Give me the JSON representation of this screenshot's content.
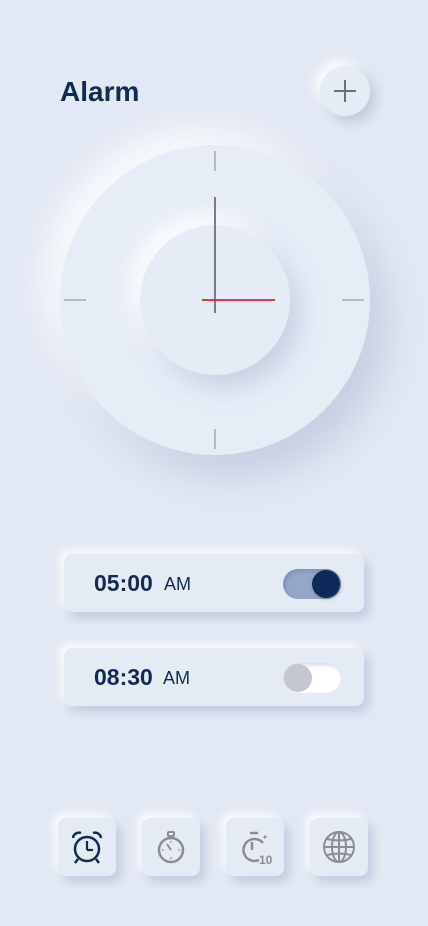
{
  "header": {
    "title": "Alarm",
    "add_icon": "plus-icon"
  },
  "clock": {
    "hour_hand_color": "#6b6f78",
    "minute_hand_color": "#e02020",
    "tick_color": "#a5a9b0"
  },
  "alarms": [
    {
      "time": "05:00",
      "ampm": "AM",
      "enabled": true
    },
    {
      "time": "08:30",
      "ampm": "AM",
      "enabled": false
    }
  ],
  "nav": {
    "items": [
      {
        "icon": "alarm-clock-icon",
        "active": true
      },
      {
        "icon": "stopwatch-icon",
        "active": false
      },
      {
        "icon": "timer-icon",
        "label": "10",
        "active": false
      },
      {
        "icon": "globe-icon",
        "active": false
      }
    ]
  },
  "colors": {
    "background": "#e3e9f4",
    "primary": "#0f2a5a",
    "inactive_icon": "#8a8d93"
  }
}
